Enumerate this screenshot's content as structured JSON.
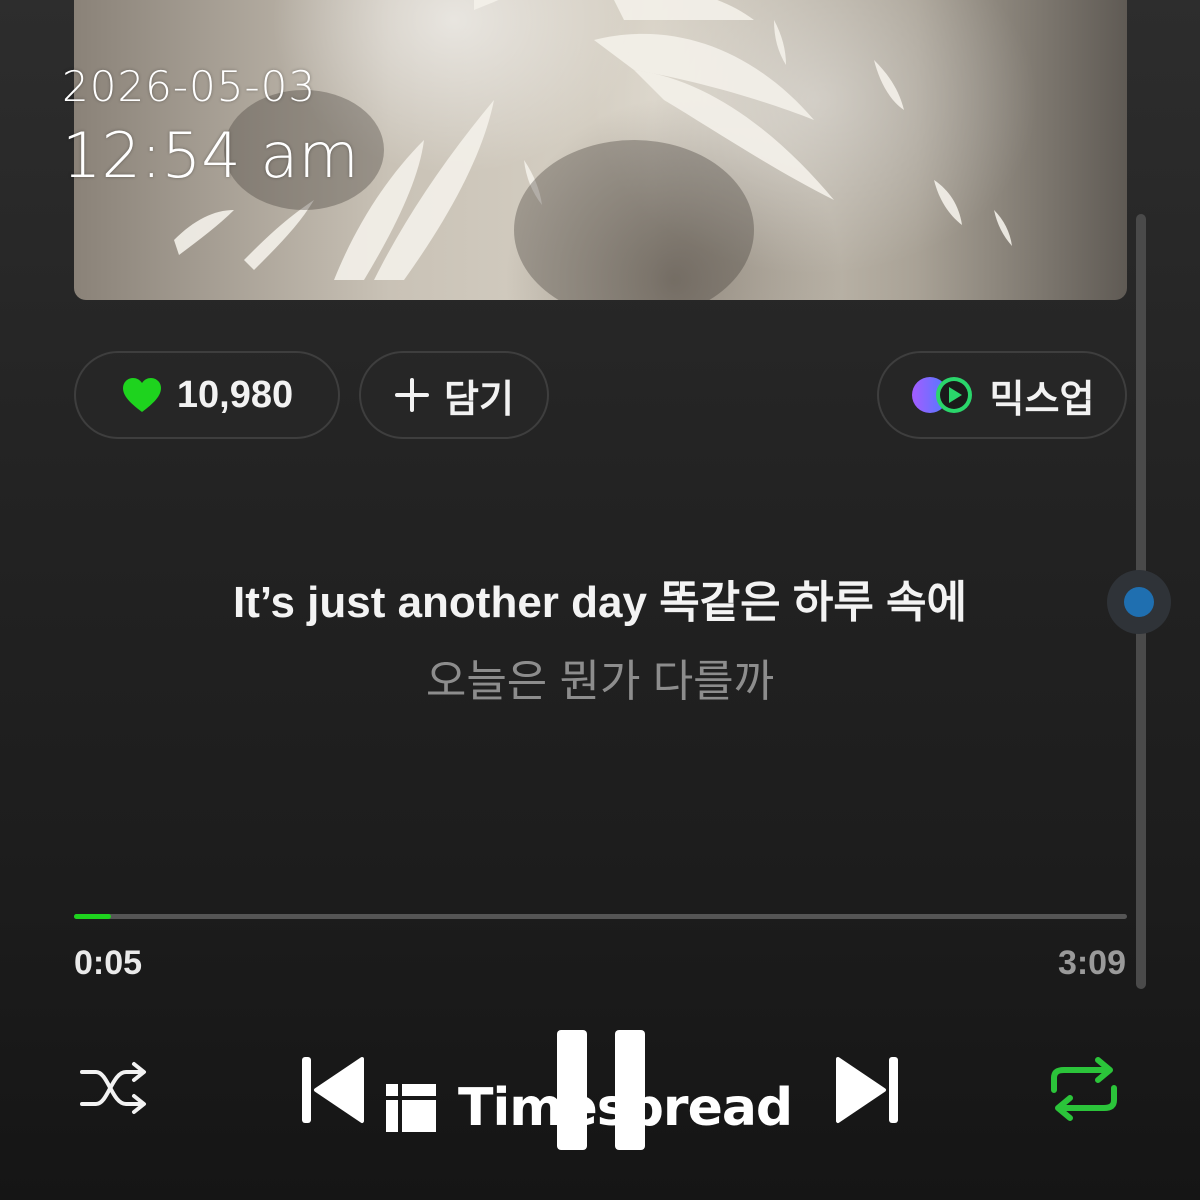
{
  "overlay": {
    "date": "2026-05-03",
    "time": "12:54 am"
  },
  "album_art": {
    "description_icon": "feathers-artwork"
  },
  "actions": {
    "like_count": "10,980",
    "add_label": "담기",
    "mixup_label": "믹스업",
    "like_color": "#1ed31e"
  },
  "lyrics": {
    "current": "It’s just another day 똑같은 하루 속에",
    "next": "오늘은 뭔가 다를까"
  },
  "playback": {
    "elapsed": "0:05",
    "total": "3:09",
    "progress_fraction": 0.035,
    "accent_color": "#1ed31e"
  },
  "controls": {
    "shuffle_icon": "shuffle-icon",
    "prev_icon": "skip-previous-icon",
    "pause_icon": "pause-icon",
    "next_icon": "skip-next-icon",
    "repeat_icon": "repeat-icon",
    "repeat_active_color": "#2bc43a"
  },
  "watermark": {
    "text": "Timespread"
  }
}
